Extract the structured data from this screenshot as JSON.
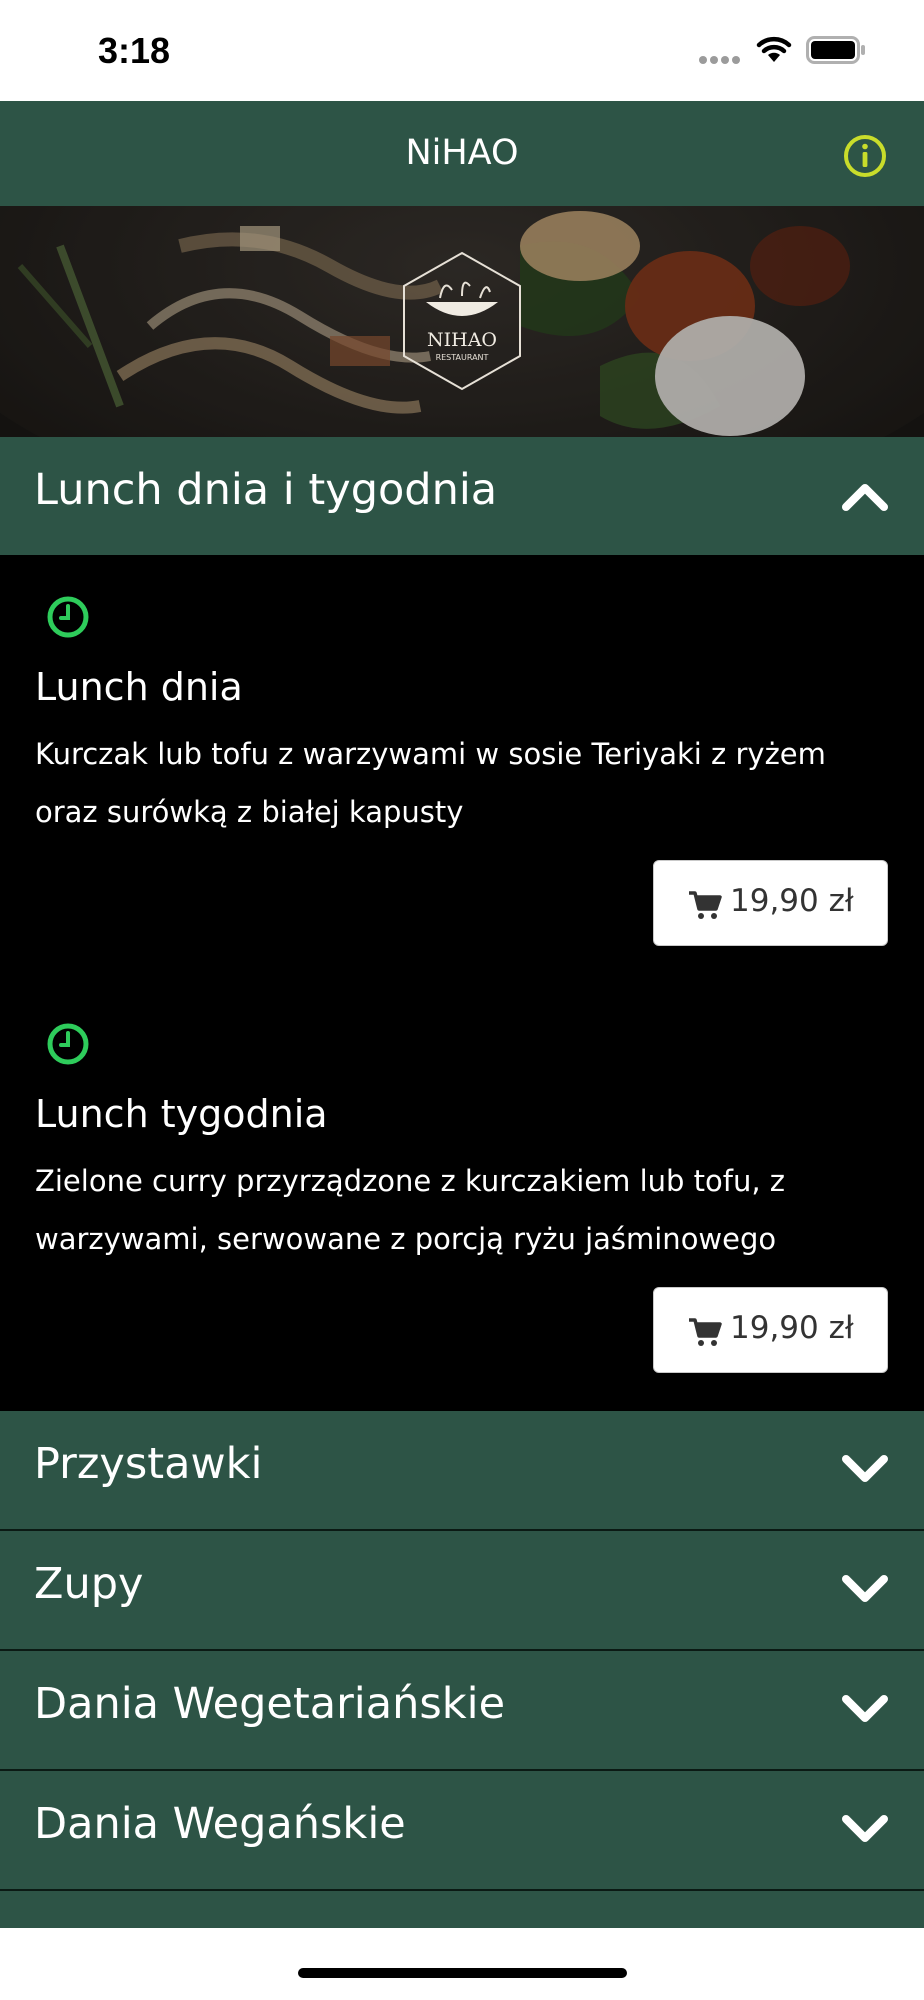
{
  "status_bar": {
    "time": "3:18"
  },
  "header": {
    "title": "NiHAO",
    "info_icon": "info-circle-icon",
    "accent": "#c9dd2b",
    "background": "#2d5446"
  },
  "hero": {
    "logo_text": "NIHAO",
    "logo_subtext": "RESTAURANT"
  },
  "sections": [
    {
      "title": "Lunch dnia i tygodnia",
      "expanded": true
    },
    {
      "title": "Przystawki",
      "expanded": false
    },
    {
      "title": "Zupy",
      "expanded": false
    },
    {
      "title": "Dania Wegetariańskie",
      "expanded": false
    },
    {
      "title": "Dania Wegańskie",
      "expanded": false
    }
  ],
  "lunch_items": [
    {
      "icon": "clock-icon",
      "name": "Lunch dnia",
      "description": "Kurczak lub tofu z warzywami w sosie Teriyaki z ryżem oraz surówką z białej kapusty",
      "price": "19,90 zł"
    },
    {
      "icon": "clock-icon",
      "name": "Lunch tygodnia",
      "description": "Zielone curry przyrządzone z kurczakiem lub tofu, z warzywami, serwowane z porcją ryżu jaśminowego",
      "price": "19,90 zł"
    }
  ],
  "colors": {
    "clock": "#2ecc5b",
    "section_bg": "#2d5446"
  }
}
